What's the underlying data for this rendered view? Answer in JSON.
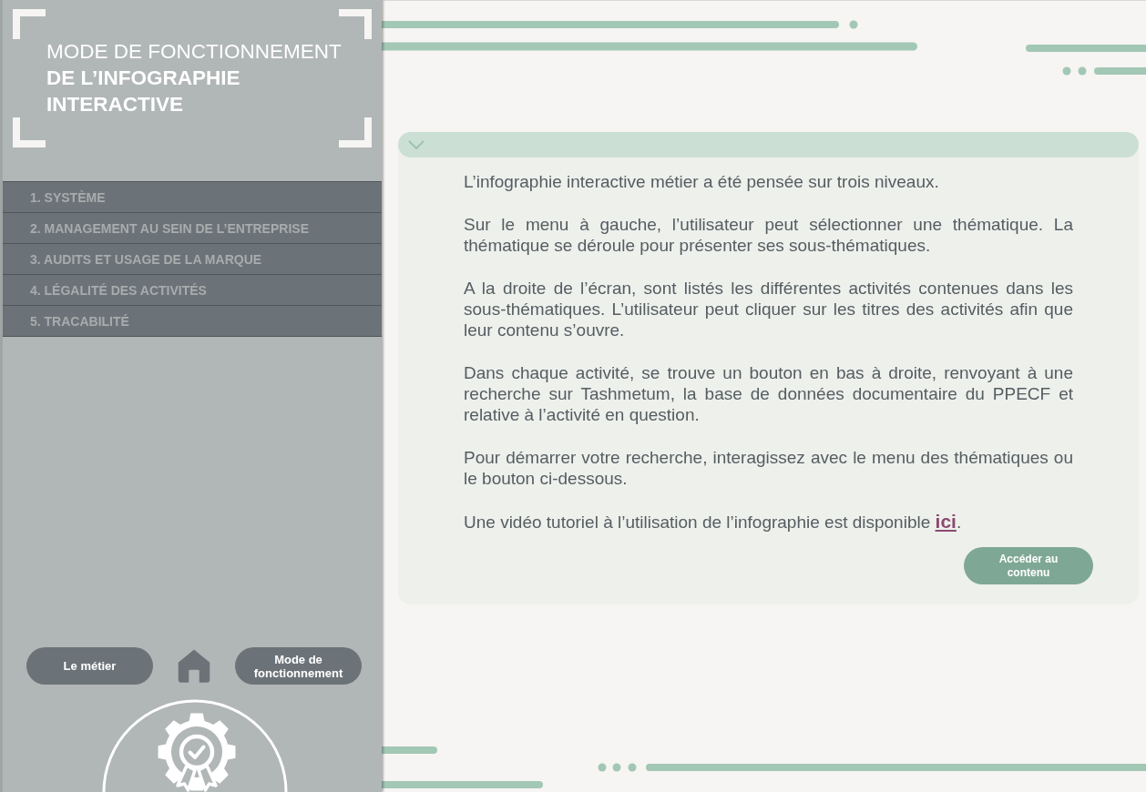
{
  "sidebar": {
    "title": "MODE DE FONCTIONNEMENT **DE L’INFOGRAPHIE INTERACTIVE**",
    "menu": [
      {
        "label": "1. SYSTÈME",
        "selected": false
      },
      {
        "label": "2. MANAGEMENT AU SEIN DE L’ENTREPRISE",
        "selected": false
      },
      {
        "label": "3. AUDITS ET USAGE DE LA MARQUE",
        "selected": false
      },
      {
        "label": "4. LÉGALITÉ DES ACTIVITÉS",
        "selected": false
      },
      {
        "label": "5. TRACABILITÉ",
        "selected": false
      }
    ],
    "nav_buttons": [
      "Le métier",
      "Mode de fonctionnement"
    ]
  },
  "content": {
    "expanded": true,
    "paragraphs": [
      "L’infographie interactive métier a été pensée sur trois niveaux.",
      "Sur le menu à gauche, l’utilisateur peut sélectionner une thématique. La thématique se déroule pour présenter ses sous-thématiques.",
      "A la droite de l’écran, sont listés les différentes activités contenues dans les sous-thématiques. L’utilisateur peut cliquer sur les titres des activités afin que leur contenu s’ouvre.",
      "Dans chaque activité, se trouve un bouton en bas à droite, renvoyant à une recherche sur Tashmetum, la base de données documentaire du PPECF et relative à l’activité en question.",
      "Pour démarrer votre recherche, interagissez avec le menu des thématiques ou le bouton ci-dessous."
    ],
    "video": {
      "text": "Une vidéo tutoriel à l’utilisation de l’infographie est disponible",
      "link": "ici",
      "after": "."
    },
    "button": "Accéder au contenu"
  }
}
